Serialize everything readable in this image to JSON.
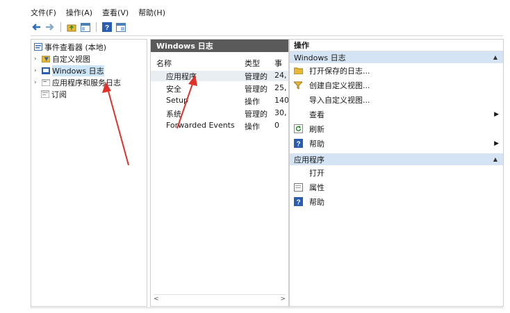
{
  "menu": [
    "文件(F)",
    "操作(A)",
    "查看(V)",
    "帮助(H)"
  ],
  "toolbar_icons": [
    "back-arrow-icon",
    "forward-arrow-icon",
    "folder-up-icon",
    "show-hide-icon",
    "help-icon",
    "properties-icon"
  ],
  "tree": {
    "root": "事件查看器 (本地)",
    "items": [
      {
        "label": "自定义视图"
      },
      {
        "label": "Windows 日志"
      },
      {
        "label": "应用程序和服务日志"
      },
      {
        "label": "订阅"
      }
    ]
  },
  "middle": {
    "title": "Windows 日志",
    "columns": [
      "名称",
      "类型",
      "事件"
    ],
    "rows": [
      {
        "name": "应用程序",
        "type": "管理的",
        "count": "24,"
      },
      {
        "name": "安全",
        "type": "管理的",
        "count": "25,"
      },
      {
        "name": "Setup",
        "type": "操作",
        "count": "140"
      },
      {
        "name": "系统",
        "type": "管理的",
        "count": "30,"
      },
      {
        "name": "Forwarded Events",
        "type": "操作",
        "count": "0"
      }
    ],
    "scroll_left": "<",
    "scroll_right": ">"
  },
  "actions": {
    "title": "操作",
    "section1": "Windows 日志",
    "items1": [
      {
        "label": "打开保存的日志...",
        "icon": "open-folder-icon"
      },
      {
        "label": "创建自定义视图...",
        "icon": "filter-icon"
      },
      {
        "label": "导入自定义视图...",
        "icon": ""
      },
      {
        "label": "查看",
        "icon": "",
        "submenu": true
      },
      {
        "label": "刷新",
        "icon": "refresh-icon"
      },
      {
        "label": "帮助",
        "icon": "help-icon",
        "submenu": true
      }
    ],
    "section2": "应用程序",
    "items2": [
      {
        "label": "打开",
        "icon": ""
      },
      {
        "label": "属性",
        "icon": "properties-icon"
      },
      {
        "label": "帮助",
        "icon": "help-icon"
      }
    ]
  },
  "colors": {
    "accent": "#d4e4f4",
    "header_dark": "#5a5a5a",
    "annotation_red": "#e0302a"
  }
}
